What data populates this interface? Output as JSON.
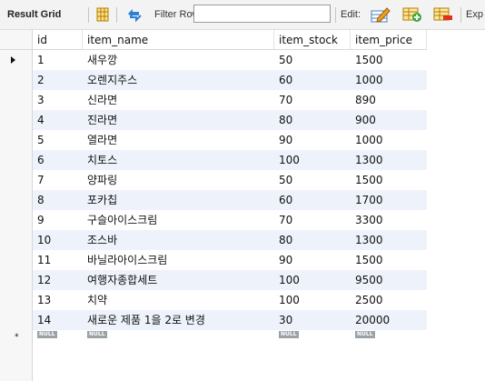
{
  "toolbar": {
    "title": "Result Grid",
    "filter_label": "Filter Rows:",
    "filter_value": "",
    "edit_label": "Edit:",
    "export_label": "Exp"
  },
  "columns": [
    "id",
    "item_name",
    "item_stock",
    "item_price"
  ],
  "rows": [
    [
      "1",
      "새우깡",
      "50",
      "1500"
    ],
    [
      "2",
      "오렌지주스",
      "60",
      "1000"
    ],
    [
      "3",
      "신라면",
      "70",
      "890"
    ],
    [
      "4",
      "진라면",
      "80",
      "900"
    ],
    [
      "5",
      "열라면",
      "90",
      "1000"
    ],
    [
      "6",
      "치토스",
      "100",
      "1300"
    ],
    [
      "7",
      "양파링",
      "50",
      "1500"
    ],
    [
      "8",
      "포카칩",
      "60",
      "1700"
    ],
    [
      "9",
      "구슬아이스크림",
      "70",
      "3300"
    ],
    [
      "10",
      "조스바",
      "80",
      "1300"
    ],
    [
      "11",
      "바닐라아이스크림",
      "90",
      "1500"
    ],
    [
      "12",
      "여행자종합세트",
      "100",
      "9500"
    ],
    [
      "13",
      "치약",
      "100",
      "2500"
    ],
    [
      "14",
      "새로운 제품 1을 2로 변경",
      "30",
      "20000"
    ]
  ],
  "new_row": [
    "NULL",
    "NULL",
    "NULL",
    "NULL"
  ],
  "colors": {
    "alt_row": "#eef2fa",
    "null_badge": "#9aa2a8"
  },
  "icons": [
    "grid-toggle-icon",
    "refresh-icon",
    "edit-row-icon",
    "add-row-icon",
    "delete-row-icon"
  ]
}
